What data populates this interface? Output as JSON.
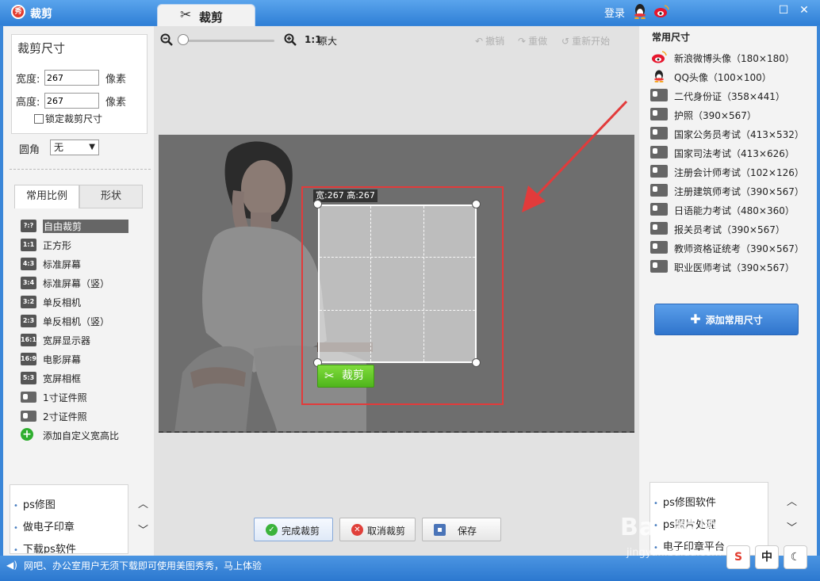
{
  "app": {
    "title": "裁剪",
    "logo_text": "秀",
    "login": "登录"
  },
  "main_tab": {
    "label": "裁剪"
  },
  "crop_size": {
    "title": "裁剪尺寸",
    "width_label": "宽度:",
    "width_value": "267",
    "height_label": "高度:",
    "height_value": "267",
    "unit": "像素",
    "lock_label": "锁定裁剪尺寸",
    "corner_label": "圆角",
    "corner_value": "无"
  },
  "tabs": [
    {
      "label": "常用比例"
    },
    {
      "label": "形状"
    }
  ],
  "ratios": [
    {
      "badge": "?:?",
      "label": "自由裁剪",
      "selected": true
    },
    {
      "badge": "1:1",
      "label": "正方形"
    },
    {
      "badge": "4:3",
      "label": "标准屏幕"
    },
    {
      "badge": "3:4",
      "label": "标准屏幕（竖）"
    },
    {
      "badge": "3:2",
      "label": "单反相机"
    },
    {
      "badge": "2:3",
      "label": "单反相机（竖）"
    },
    {
      "badge": "16:10",
      "label": "宽屏显示器"
    },
    {
      "badge": "16:9",
      "label": "电影屏幕"
    },
    {
      "badge": "5:3",
      "label": "宽屏相框"
    },
    {
      "badge": "",
      "label": "1寸证件照"
    },
    {
      "badge": "",
      "label": "2寸证件照"
    },
    {
      "badge": "",
      "label": "添加自定义宽高比"
    }
  ],
  "left_links": [
    "ps修图",
    "做电子印章",
    "下载ps软件"
  ],
  "toolbar": {
    "ratio": "1:1",
    "original_size": "原大",
    "undo": "撤销",
    "redo": "重做",
    "restart": "重新开始"
  },
  "crop": {
    "dimension_label": "宽:267 高:267",
    "button": "裁剪"
  },
  "bottom_buttons": {
    "done": "完成裁剪",
    "cancel": "取消裁剪",
    "save": "保存"
  },
  "presets_title": "常用尺寸",
  "presets": [
    {
      "icon": "weibo",
      "label": "新浪微博头像（180×180）"
    },
    {
      "icon": "qq",
      "label": "QQ头像（100×100）"
    },
    {
      "icon": "idcard",
      "label": "二代身份证（358×441）"
    },
    {
      "icon": "idcard",
      "label": "护照（390×567）"
    },
    {
      "icon": "idcard",
      "label": "国家公务员考试（413×532）"
    },
    {
      "icon": "idcard",
      "label": "国家司法考试（413×626）"
    },
    {
      "icon": "idcard",
      "label": "注册会计师考试（102×126）"
    },
    {
      "icon": "idcard",
      "label": "注册建筑师考试（390×567）"
    },
    {
      "icon": "idcard",
      "label": "日语能力考试（480×360）"
    },
    {
      "icon": "idcard",
      "label": "报关员考试（390×567）"
    },
    {
      "icon": "idcard",
      "label": "教师资格证统考（390×567）"
    },
    {
      "icon": "idcard",
      "label": "职业医师考试（390×567）"
    }
  ],
  "add_size_button": "添加常用尺寸",
  "right_links": [
    "ps修图软件",
    "ps照片处理",
    "电子印章平台"
  ],
  "status_text": "网吧、办公室用户无须下载即可使用美图秀秀，马上体验",
  "tray": {
    "zhong": "中"
  },
  "watermark": {
    "main": "Bai 经验",
    "sub": "jingyan.baidu.com"
  },
  "colors": {
    "accent": "#2f7fd6",
    "crop_green": "#4fb51c",
    "highlight_red": "#e23b3b"
  }
}
